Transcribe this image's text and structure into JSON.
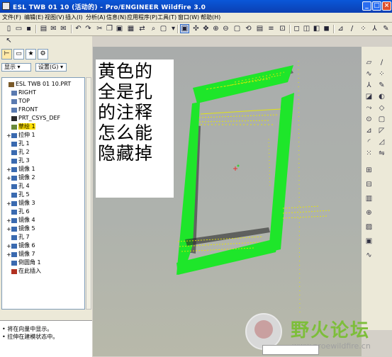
{
  "window": {
    "title": "ESL TWB 01 10 (活动的) - Pro/ENGINEER Wildfire 3.0",
    "min": "_",
    "max": "□",
    "close": "×"
  },
  "menu": [
    "文件(F)",
    "编辑(E)",
    "视图(V)",
    "插入(I)",
    "分析(A)",
    "信息(N)",
    "应用程序(P)",
    "工具(T)",
    "窗口(W)",
    "帮助(H)"
  ],
  "panel": {
    "show_label": "显示 ▾",
    "settings_label": "设置(G) ▾"
  },
  "tree": {
    "rows": [
      {
        "exp": "",
        "label": "ESL TWB 01 10.PRT"
      },
      {
        "exp": "",
        "label": "RIGHT"
      },
      {
        "exp": "",
        "label": "TOP"
      },
      {
        "exp": "",
        "label": "FRONT"
      },
      {
        "exp": "",
        "label": "PRT_CSYS_DEF"
      },
      {
        "exp": "",
        "label": "草绘 1",
        "sel": true
      },
      {
        "exp": "+",
        "label": "拉伸 1"
      },
      {
        "exp": "",
        "label": "孔 1"
      },
      {
        "exp": "",
        "label": "孔 2"
      },
      {
        "exp": "",
        "label": "孔 3"
      },
      {
        "exp": "+",
        "label": "镜像 1"
      },
      {
        "exp": "+",
        "label": "镜像 2"
      },
      {
        "exp": "",
        "label": "孔 4"
      },
      {
        "exp": "",
        "label": "孔 5"
      },
      {
        "exp": "+",
        "label": "镜像 3"
      },
      {
        "exp": "",
        "label": "孔 6"
      },
      {
        "exp": "+",
        "label": "镜像 4"
      },
      {
        "exp": "+",
        "label": "镜像 5"
      },
      {
        "exp": "",
        "label": "孔 7"
      },
      {
        "exp": "+",
        "label": "镜像 6"
      },
      {
        "exp": "+",
        "label": "镜像 7"
      },
      {
        "exp": "",
        "label": "倒圆角 1"
      },
      {
        "exp": "",
        "label": "在此插入"
      }
    ]
  },
  "status": {
    "lines": [
      "• 将在向量中显示。",
      "• 拉伸在建模状态中。"
    ]
  },
  "note": {
    "lines": [
      "黄色的",
      "全是孔",
      "的注释",
      "怎么能",
      "隐藏掉"
    ]
  },
  "watermark": {
    "text": "野火论坛",
    "url": "www.proewildfire.cn"
  },
  "colors": {
    "frame": "#1ee62a",
    "annotation": "#e8e800",
    "titlebar": "#0a57d8"
  }
}
